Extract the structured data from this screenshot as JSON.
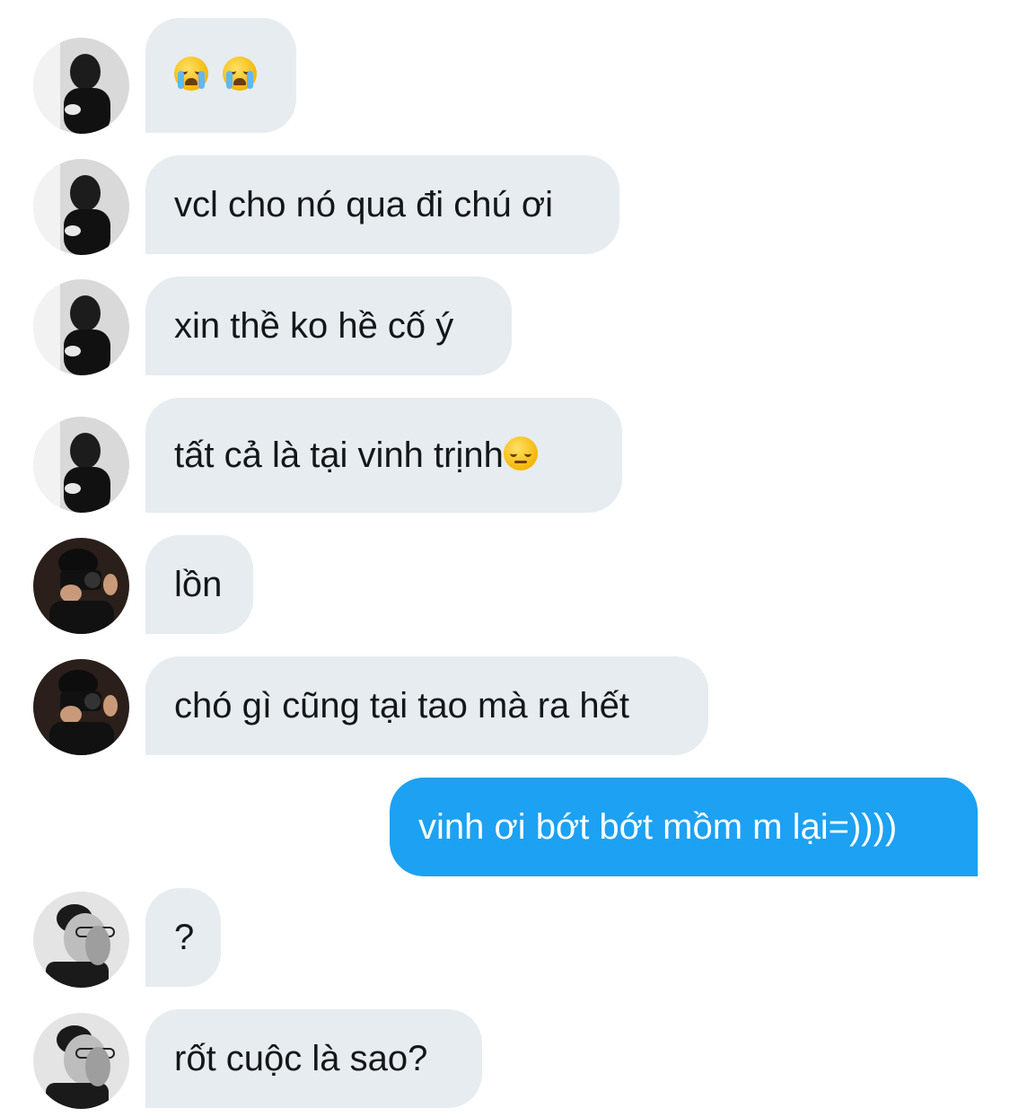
{
  "conversation": {
    "messages": [
      {
        "sender": "contact-a",
        "text": "",
        "emojis": [
          "loudly-crying-face-emoji",
          "loudly-crying-face-emoji"
        ]
      },
      {
        "sender": "contact-a",
        "text": "vcl cho nó qua đi chú ơi"
      },
      {
        "sender": "contact-a",
        "text": "xin thề ko hề cố ý"
      },
      {
        "sender": "contact-a",
        "text": "tất cả là tại vinh trịnh",
        "emojis": [
          "pensive-face-emoji"
        ]
      },
      {
        "sender": "contact-b",
        "text": "lồn"
      },
      {
        "sender": "contact-b",
        "text": "chó gì cũng tại tao mà ra hết"
      },
      {
        "sender": "me",
        "text": "vinh ơi bớt bớt mồm m lại=))))"
      },
      {
        "sender": "contact-c",
        "text": "?"
      },
      {
        "sender": "contact-c",
        "text": "rốt cuộc là sao?"
      }
    ]
  },
  "colors": {
    "incoming_bubble": "#e6ecf0",
    "incoming_text": "#14171a",
    "outgoing_bubble": "#1da1f2",
    "outgoing_text": "#ffffff"
  }
}
